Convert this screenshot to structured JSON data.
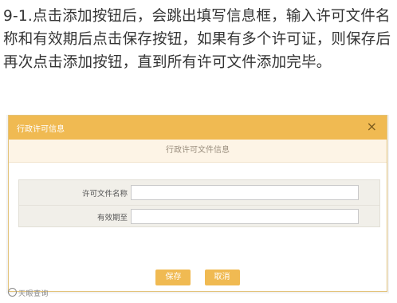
{
  "instruction": {
    "text": "9-1.点击添加按钮后，会跳出填写信息框，输入许可文件名称和有效期后点击保存按钮，如果有多个许可证，则保存后再次点击添加按钮，直到所有许可文件添加完毕。"
  },
  "dialog": {
    "title": "行政许可信息",
    "close_icon": "close-icon",
    "close_label": "×",
    "subtitle": "行政许可文件信息",
    "fields": [
      {
        "label": "许可文件名称",
        "value": "",
        "placeholder": ""
      },
      {
        "label": "有效期至",
        "value": "",
        "placeholder": ""
      }
    ],
    "buttons": {
      "save": "保存",
      "cancel": "取消"
    }
  },
  "watermark": {
    "text": "天眼查询"
  },
  "colors": {
    "header": "#f0ba52",
    "button": "#f0ba52",
    "subheader_bg": "#fdf4e6",
    "form_bg": "#f1efe9"
  }
}
